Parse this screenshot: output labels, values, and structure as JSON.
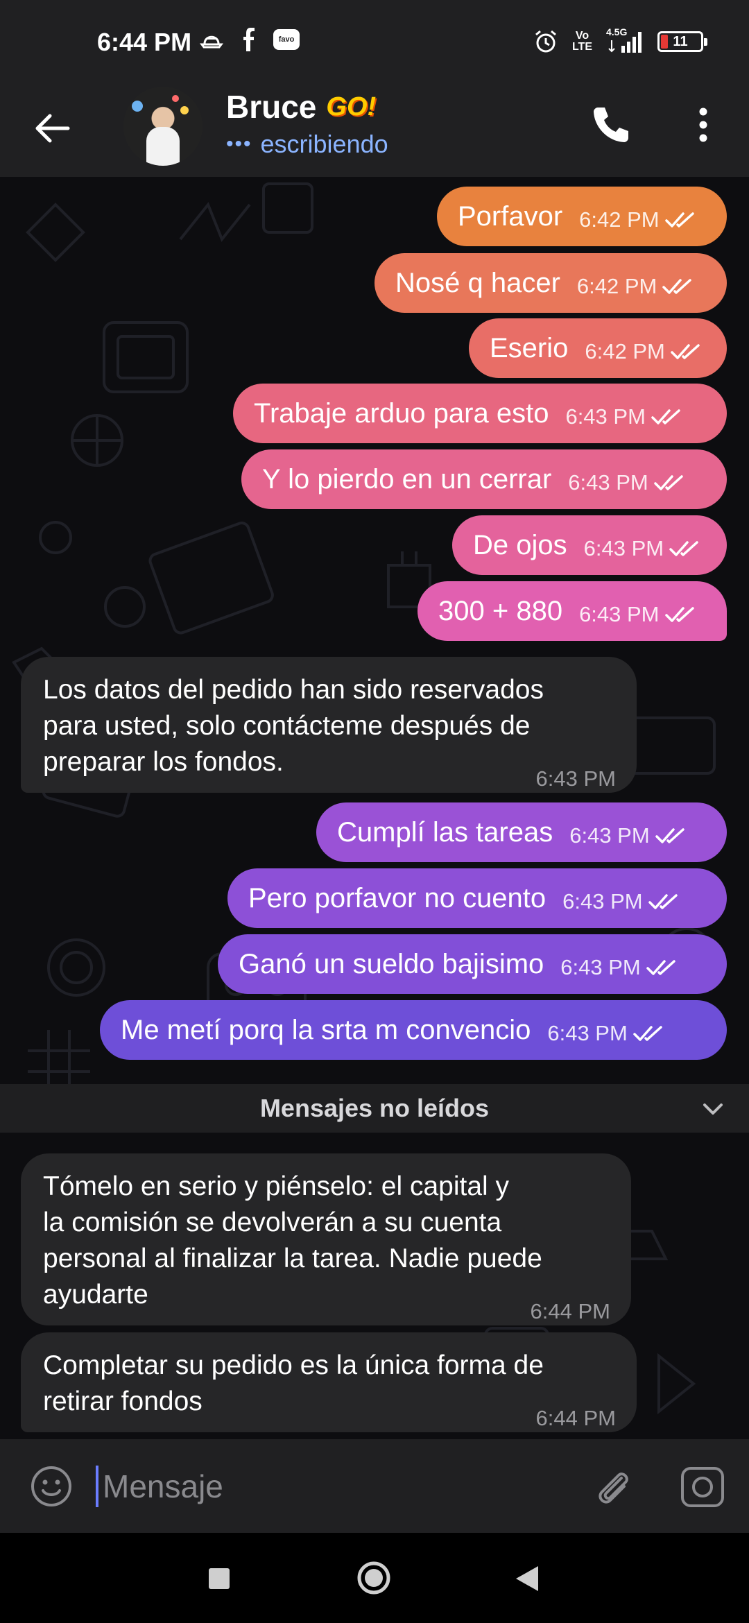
{
  "status_bar": {
    "time": "6:44 PM",
    "left_icons": [
      "hat-icon",
      "facebook-icon",
      "favo-icon"
    ],
    "favo_label": "favo",
    "network": "4.5G",
    "volte_top": "Vo",
    "volte_bottom": "LTE",
    "battery": "11"
  },
  "header": {
    "name": "Bruce",
    "badge": "GO!",
    "status": "escribiendo",
    "status_color": "#8bb4ff"
  },
  "outgoing_messages": [
    {
      "text": "Porfavor",
      "time": "6:42 PM"
    },
    {
      "text": "Nosé q hacer",
      "time": "6:42 PM"
    },
    {
      "text": "Eserio",
      "time": "6:42 PM"
    },
    {
      "text": "Trabaje arduo para esto",
      "time": "6:43 PM"
    },
    {
      "text": "Y lo pierdo en un cerrar",
      "time": "6:43 PM"
    },
    {
      "text": "De ojos",
      "time": "6:43 PM"
    },
    {
      "text": "300 + 880",
      "time": "6:43 PM"
    },
    {
      "text": "Cumplí las tareas",
      "time": "6:43 PM"
    },
    {
      "text": "Pero porfavor no cuento",
      "time": "6:43 PM"
    },
    {
      "text": "Ganó un sueldo bajisimo",
      "time": "6:43 PM"
    },
    {
      "text": "Me metí porq la srta m convencio",
      "time": "6:43 PM"
    }
  ],
  "incoming_messages": [
    {
      "lines": [
        "Los datos del pedido han sido reservados",
        "para usted, solo contácteme después de",
        "preparar los fondos."
      ],
      "time": "6:43 PM"
    },
    {
      "lines": [
        "Tómelo en serio y piénselo: el capital y",
        "la comisión se devolverán a su cuenta",
        "personal al finalizar la tarea. Nadie puede",
        "ayudarte"
      ],
      "time": "6:44 PM"
    },
    {
      "lines": [
        "Completar su pedido es la única forma de",
        "retirar fondos"
      ],
      "time": "6:44 PM"
    }
  ],
  "unread_label": "Mensajes no leídos",
  "input": {
    "placeholder": "Mensaje"
  },
  "colors": {
    "bubble_orange": "#e8823e",
    "bubble_pink": "#e462a6",
    "bubble_purple": "#7f4fd6",
    "incoming": "#262628",
    "header": "#202022"
  }
}
